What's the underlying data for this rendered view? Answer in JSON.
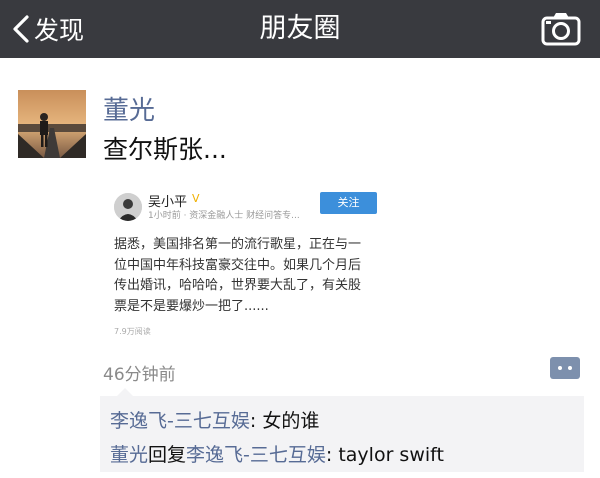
{
  "navbar": {
    "back_label": "发现",
    "title": "朋友圈"
  },
  "post": {
    "author": "董光",
    "text": "查尔斯张...",
    "time": "46分钟前",
    "embedded": {
      "name": "吴小平",
      "verified_mark": "V",
      "meta": "1小时前 · 资深金融人士 财经问答专...",
      "follow_label": "关注",
      "body_lines": [
        "据悉，美国排名第一的流行歌星，正在与一",
        "位中国中年科技富豪交往中。如果几个月后",
        "传出婚讯，哈哈哈，世界要大乱了，有关股",
        "票是不是要爆炒一把了......"
      ],
      "reads": "7.9万阅读"
    }
  },
  "comments": [
    {
      "author": "李逸飞-三七互娱",
      "separator": ": ",
      "text": "女的谁"
    },
    {
      "author": "董光",
      "reply_word": "回复",
      "reply_to": "李逸飞-三七互娱",
      "separator": ": ",
      "text": "taylor swift"
    }
  ],
  "colors": {
    "navbar_bg": "#393a3f",
    "name_link": "#576b95",
    "follow_button": "#3c8fdb",
    "comment_bg": "#f3f3f5"
  },
  "icons": {
    "back": "chevron-left-icon",
    "camera": "camera-icon",
    "comment": "comment-icon",
    "verified": "verified-v-icon"
  }
}
